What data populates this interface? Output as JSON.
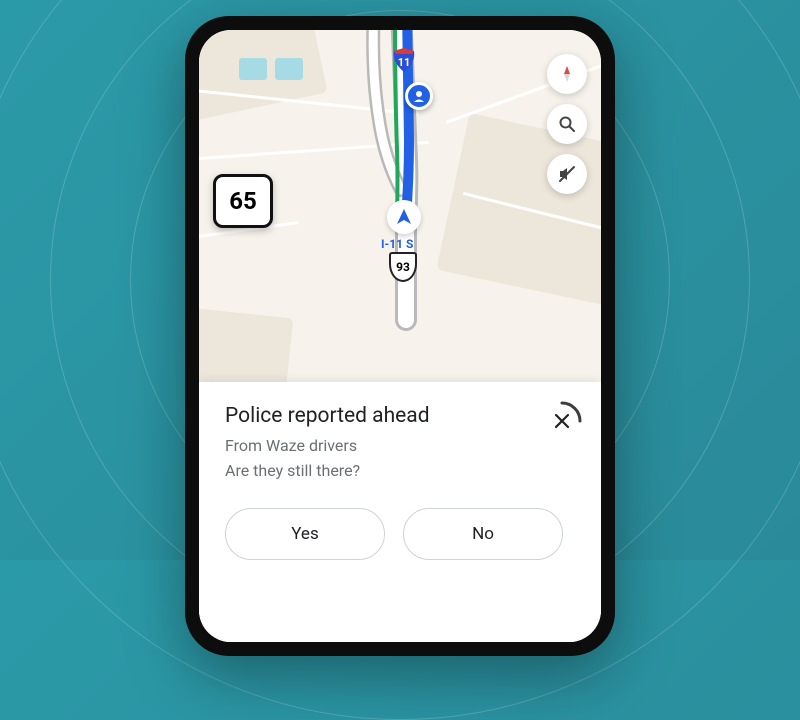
{
  "speed_limit": "65",
  "route_label": "I-11 S",
  "us_shield": "93",
  "interstate_number": "11",
  "sheet": {
    "title": "Police reported ahead",
    "source": "From Waze drivers",
    "question": "Are they still there?",
    "yes": "Yes",
    "no": "No"
  }
}
